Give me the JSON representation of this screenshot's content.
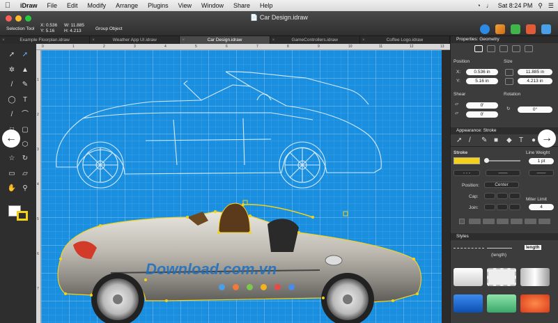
{
  "menubar": {
    "app": "iDraw",
    "items": [
      "File",
      "Edit",
      "Modify",
      "Arrange",
      "Plugins",
      "View",
      "Window",
      "Share",
      "Help"
    ],
    "clock": "Sat 8:24 PM"
  },
  "window": {
    "title": "Car Design.idraw"
  },
  "toolbar": {
    "tool_name": "Selection Tool",
    "x": "X:  0.536",
    "y": "Y:  5.16",
    "w": "W:  11.885",
    "h": "H:  4.213",
    "object": "Group Object"
  },
  "tabs": [
    "Example Floorplan.idraw",
    "Weather App UI.idraw",
    "Car Design.idraw",
    "GameControllers.idraw",
    "Coffee Logo.idraw"
  ],
  "ruler": {
    "top": [
      "0",
      "1",
      "2",
      "3",
      "4",
      "5",
      "6",
      "7",
      "8",
      "9",
      "10",
      "11",
      "12",
      "13"
    ],
    "left": [
      "1",
      "2",
      "3",
      "4",
      "5",
      "6",
      "7"
    ]
  },
  "properties": {
    "header": "Properties:",
    "subject": "Geometry",
    "position_label": "Position",
    "size_label": "Size",
    "x_label": "X:",
    "x_value": "0.536 in",
    "y_label": "Y:",
    "y_value": "5.16 in",
    "w_value": "11.885 in",
    "h_value": "4.213 in",
    "shear_label": "Shear",
    "rotation_label": "Rotation",
    "shear_x": "0'",
    "shear_y": "0'",
    "rotation": "0°"
  },
  "appearance": {
    "header": "Appearance:",
    "subject": "Stroke",
    "stroke_label": "Stroke",
    "line_weight_label": "Line Weight",
    "line_weight": "1 pt",
    "position_label": "Position:",
    "position_value": "Center",
    "cap_label": "Cap:",
    "join_label": "Join:",
    "miter_label": "Miter Limit",
    "miter_value": "4"
  },
  "styles": {
    "header": "Styles",
    "length_label": "(length)",
    "length_tag": "length"
  },
  "watermark": "Download.com.vn",
  "colors": {
    "canvas": "#1a8fe0",
    "stroke": "#f5d21a"
  }
}
